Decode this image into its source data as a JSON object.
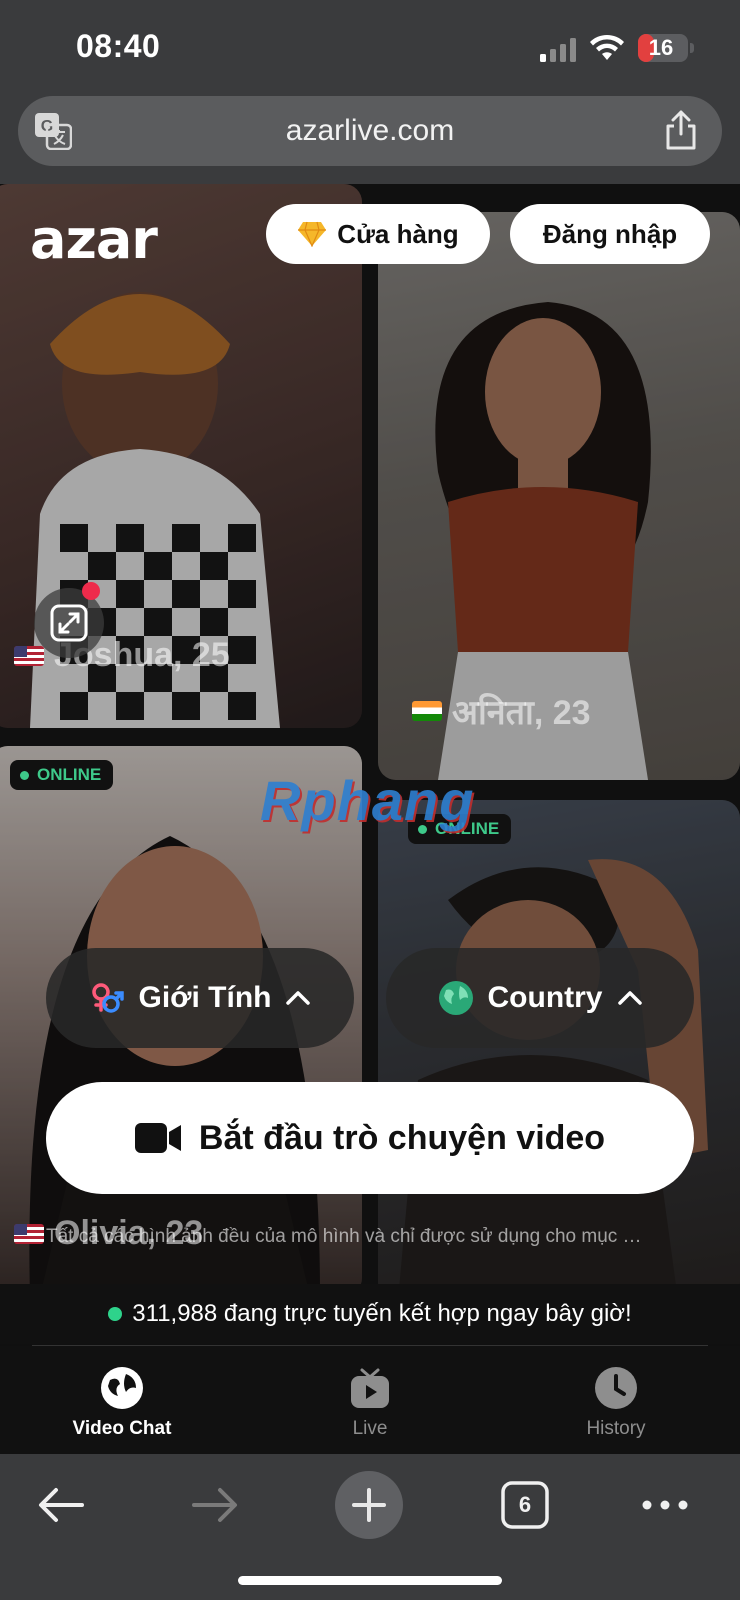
{
  "status_bar": {
    "time": "08:40",
    "battery_level": "16",
    "battery_fraction": 0.16,
    "battery_color": "#e2403f"
  },
  "browser": {
    "url": "azarlive.com",
    "tab_count": "6"
  },
  "header": {
    "logo": "azar",
    "store_label": "Cửa hàng",
    "login_label": "Đăng nhập"
  },
  "cards": [
    {
      "name": "Joshua, 25",
      "country_flag": "us",
      "online": ""
    },
    {
      "name": "अनिता, 23",
      "country_flag": "in",
      "online": ""
    },
    {
      "name": "Olivia, 23",
      "country_flag": "us",
      "online": "ONLINE"
    },
    {
      "name": "",
      "country_flag": "",
      "online": "ONLINE"
    }
  ],
  "watermark": "Rphang",
  "filters": {
    "gender_label": "Giới Tính",
    "country_label": "Country"
  },
  "start_button_label": "Bắt đầu trò chuyện video",
  "disclaimer": "Tất cả các hình ảnh đều của mô hình và chỉ được sử dụng cho mục …",
  "online_count_text": "311,988 đang trực tuyến kết hợp ngay bây giờ!",
  "tabs": [
    {
      "label": "Video Chat",
      "icon": "globe-icon",
      "active": true
    },
    {
      "label": "Live",
      "icon": "tv-play-icon",
      "active": false
    },
    {
      "label": "History",
      "icon": "clock-icon",
      "active": false
    }
  ],
  "colors": {
    "online_green": "#3ec98a",
    "accent_white": "#ffffff",
    "store_gem": "#f5b72a"
  }
}
